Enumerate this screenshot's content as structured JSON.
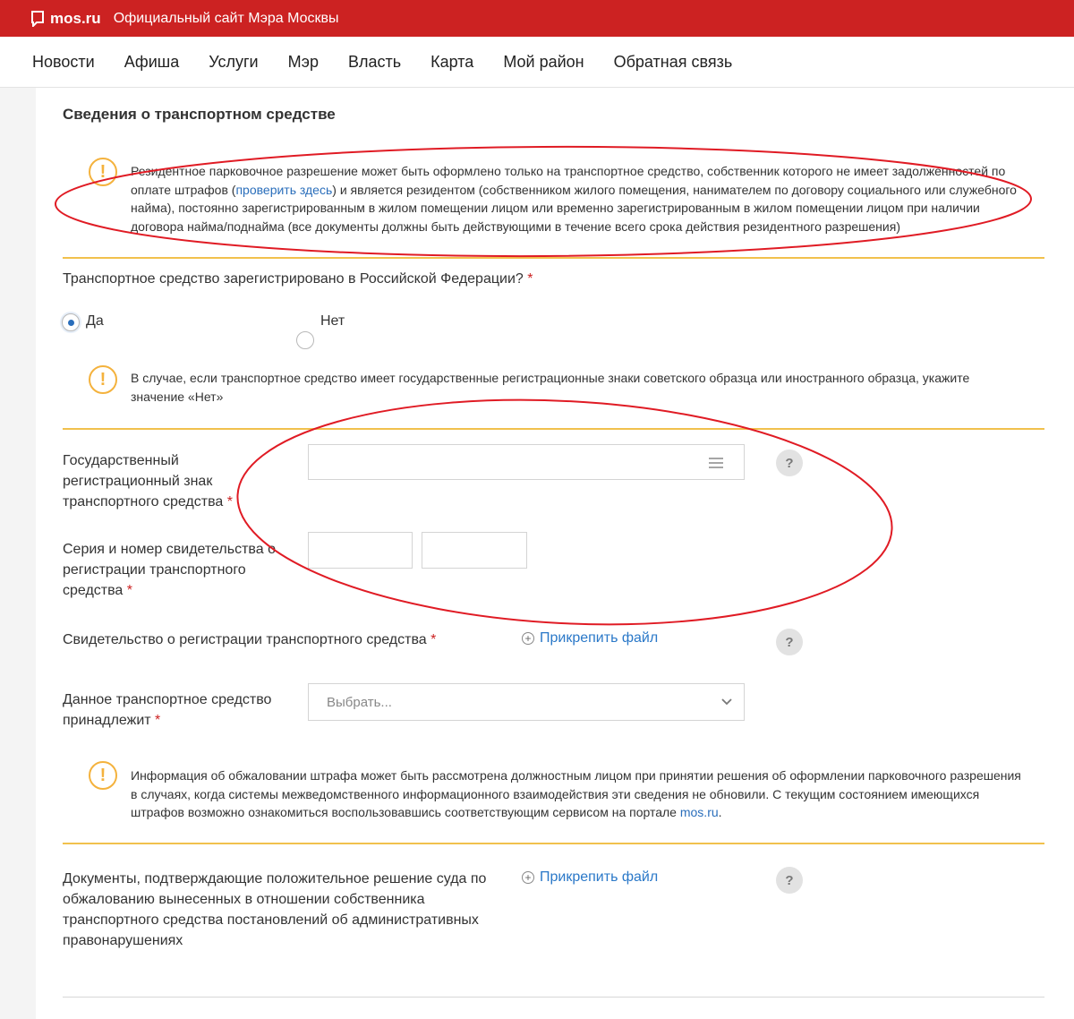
{
  "header": {
    "brand": "mos.ru",
    "site_title": "Официальный сайт Мэра Москвы",
    "brand_color": "#cc2222"
  },
  "nav": {
    "items": [
      "Новости",
      "Афиша",
      "Услуги",
      "Мэр",
      "Власть",
      "Карта",
      "Мой район",
      "Обратная связь"
    ]
  },
  "form": {
    "section_title": "Сведения о транспортном средстве",
    "notice1": {
      "before": "Резидентное парковочное разрешение может быть оформлено только на транспортное средство, собственник которого не имеет задолженностей по оплате штрафов (",
      "link": "проверить здесь",
      "after": ") и является резидентом (собственником жилого помещения, нанимателем по договору социального или служебного найма), постоянно зарегистрированным в жилом помещении лицом или временно зарегистрированным в жилом помещении лицом при наличии договора найма/поднайма (все документы должны быть действующими в течение всего срока действия резидентного разрешения)"
    },
    "registered_question": "Транспортное средство зарегистрировано в Российской Федерации?",
    "required_mark": "*",
    "radio_yes": "Да",
    "radio_no": "Нет",
    "selected": "Да",
    "notice2": "В случае, если транспортное средство имеет государственные регистрационные знаки советского образца или иностранного образца, укажите значение «Нет»",
    "plate_label": "Государственный регистрационный знак транспортного средства",
    "cert_label": "Серия и номер свидетельства о регистрации транспортного средства",
    "cert_file_label": "Свидетельство о регистрации транспортного средства",
    "attach_label": "Прикрепить файл",
    "owner_label": "Данное транспортное средство принадлежит",
    "owner_placeholder": "Выбрать...",
    "notice3": {
      "before": "Информация об обжаловании штрафа может быть рассмотрена должностным лицом при принятии решения об оформлении парковочного разрешения в случаях, когда системы межведомственного информационного взаимодействия эти сведения не обновили. С текущим состоянием имеющихся штрафов возможно ознакомиться воспользовавшись соответствующим сервисом на портале ",
      "link": "mos.ru",
      "after": "."
    },
    "court_docs_label": "Документы, подтверждающие положительное решение суда по обжалованию вынесенных в отношении собственника транспортного средства постановлений об административных правонарушениях",
    "help_glyph": "?",
    "warn_glyph": "!"
  },
  "colors": {
    "accent": "#2a6ebb",
    "warning": "#f4b23d",
    "divider": "#f1c14d",
    "annotation": "#e01b24"
  }
}
